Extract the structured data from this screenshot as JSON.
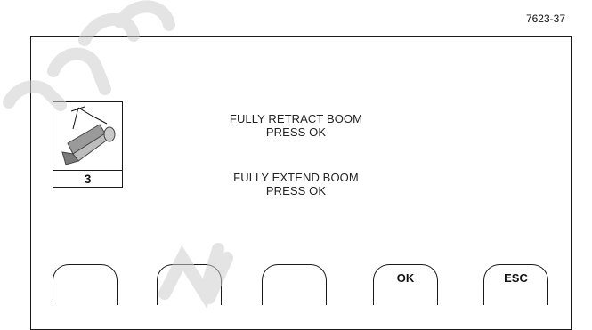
{
  "figure_id": "7623-37",
  "icon": {
    "name": "boom-length-icon",
    "step_number": "3"
  },
  "messages": [
    {
      "line1": "FULLY RETRACT BOOM",
      "line2": "PRESS OK"
    },
    {
      "line1": "FULLY EXTEND BOOM",
      "line2": "PRESS OK"
    }
  ],
  "softkeys": [
    "",
    "",
    "",
    "OK",
    "ESC"
  ],
  "watermark_text": "nce         IV"
}
